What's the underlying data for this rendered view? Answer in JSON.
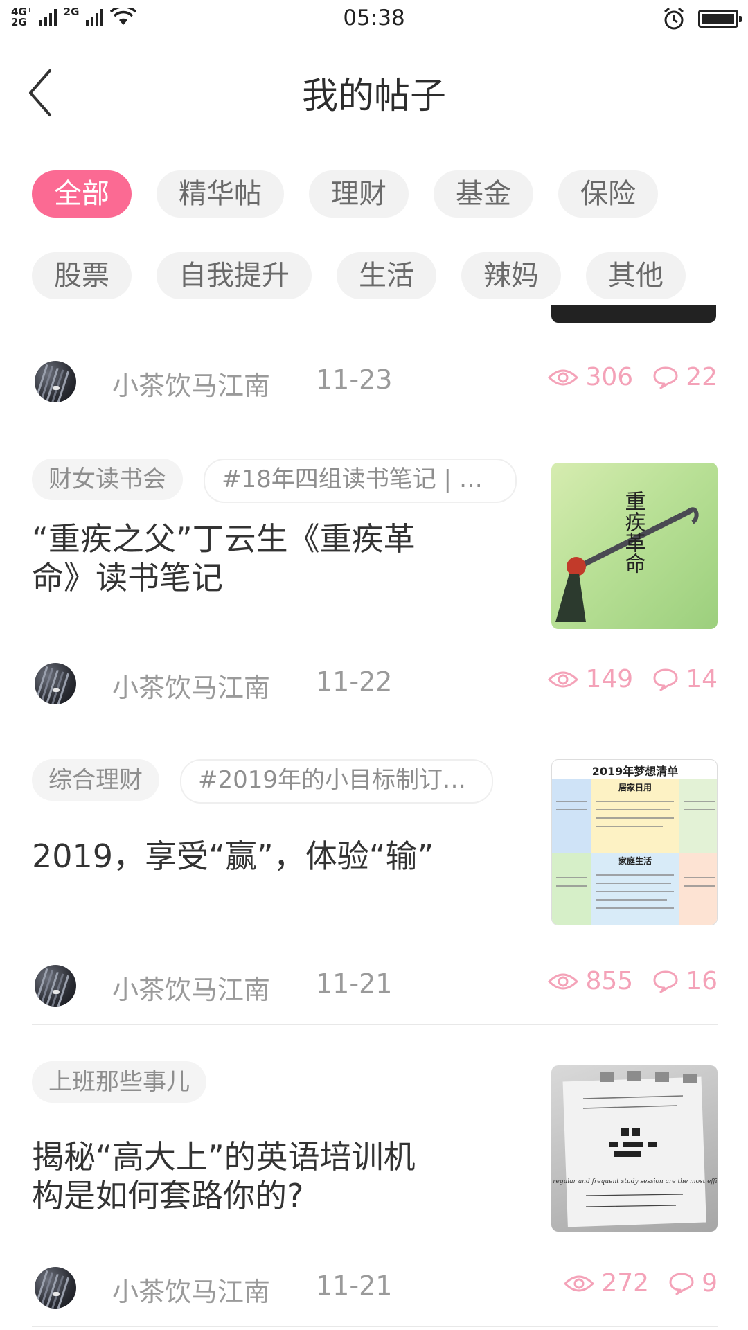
{
  "status_bar": {
    "network_top": "4G⁺",
    "network_bottom": "2G",
    "network_2": "2G",
    "time": "05:38"
  },
  "header": {
    "title": "我的帖子"
  },
  "filters": {
    "row1": [
      "全部",
      "精华帖",
      "理财",
      "基金",
      "保险"
    ],
    "row2": [
      "股票",
      "自我提升",
      "生活",
      "辣妈",
      "其他"
    ],
    "active": "全部"
  },
  "colors": {
    "accent": "#fb6a93",
    "stats": "#f4a2b8"
  },
  "posts": [
    {
      "author": "小茶饮马江南",
      "date": "11-23",
      "views": "306",
      "comments": "22"
    },
    {
      "tags": [
        "财女读书会",
        "#18年四组读书笔记 | 财..."
      ],
      "title": "“重疾之父”丁云生《重疾革命》读书笔记",
      "thumb_text": "重疾革命",
      "author": "小茶饮马江南",
      "date": "11-22",
      "views": "149",
      "comments": "14"
    },
    {
      "tags": [
        "综合理财",
        "#2019年的小目标制订好..."
      ],
      "title": "2019，享受“赢”，体验“输”",
      "thumb_text": "2019年梦想清单",
      "thumb_headers": [
        "居家日用",
        "家庭生活"
      ],
      "author": "小茶饮马江南",
      "date": "11-21",
      "views": "855",
      "comments": "16"
    },
    {
      "tags": [
        "上班那些事儿"
      ],
      "title": "揭秘“高大上”的英语培训机构是如何套路你的?",
      "thumb_text": "Short regular and frequent study session are the most efficient!",
      "author": "小茶饮马江南",
      "date": "11-21",
      "views": "272",
      "comments": "9"
    }
  ]
}
